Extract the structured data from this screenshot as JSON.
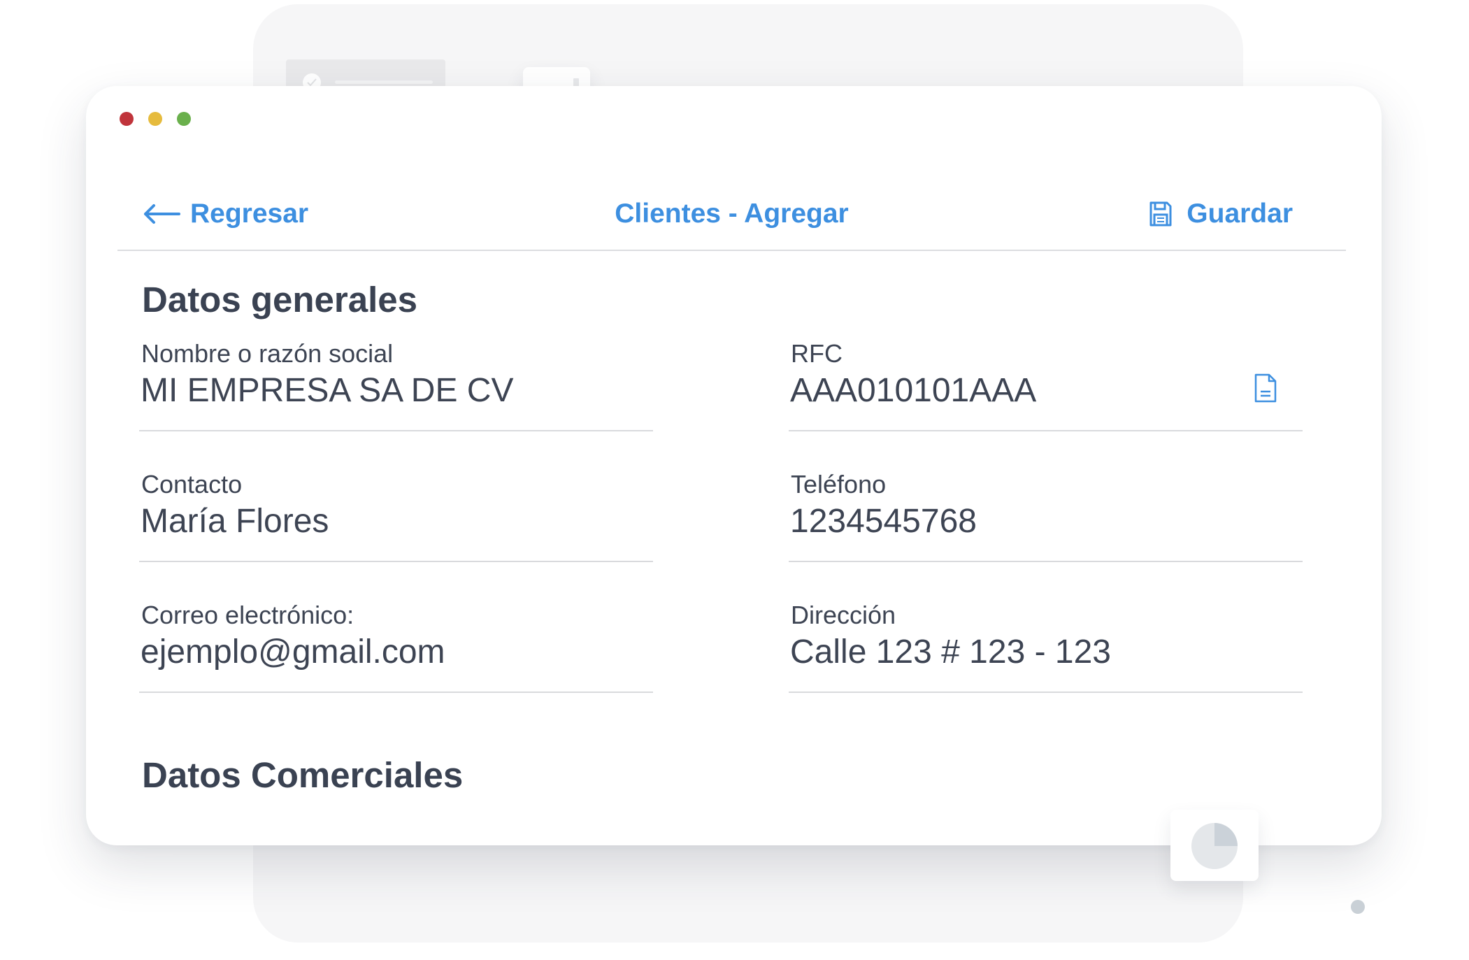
{
  "window": {
    "dots": [
      "close",
      "minimize",
      "maximize"
    ]
  },
  "header": {
    "back_label": "Regresar",
    "title": "Clientes - Agregar",
    "save_label": "Guardar"
  },
  "sections": {
    "general_title": "Datos generales",
    "commercial_title": "Datos Comerciales"
  },
  "fields": {
    "nombre": {
      "label": "Nombre o razón social",
      "value": "MI EMPRESA SA DE CV"
    },
    "rfc": {
      "label": "RFC",
      "value": "AAA010101AAA"
    },
    "contacto": {
      "label": "Contacto",
      "value": "María Flores"
    },
    "telefono": {
      "label": "Teléfono",
      "value": "1234545768"
    },
    "correo": {
      "label": "Correo electrónico:",
      "value": "ejemplo@gmail.com"
    },
    "direccion": {
      "label": "Dirección",
      "value": "Calle 123 # 123 - 123"
    }
  },
  "icons": {
    "back": "arrow-left-icon",
    "save": "floppy-disk-icon",
    "rfc_action": "document-icon",
    "decor_check": "check-icon",
    "decor_bars": "bar-chart-icon",
    "decor_pie": "pie-chart-icon"
  },
  "colors": {
    "accent": "#3d8fe0",
    "text": "#3d4453",
    "title": "#3a4252",
    "divider": "#d9dadd",
    "dot_red": "#c0343b",
    "dot_yellow": "#e6bb3d",
    "dot_green": "#6ab04c"
  }
}
